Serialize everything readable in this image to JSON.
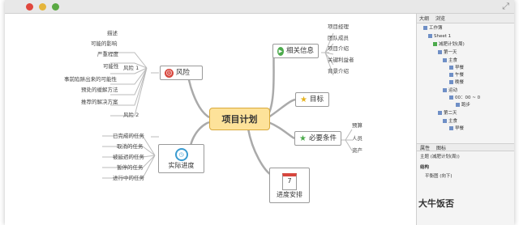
{
  "window": {
    "controls": [
      "close",
      "minimize",
      "zoom"
    ]
  },
  "map": {
    "central": "项目计划",
    "risk": {
      "label": "风险",
      "sub1": "风险 1",
      "sub2": "风险 2",
      "leaves": [
        "描述",
        "可能的影响",
        "严重程度",
        "可能性",
        "事前陷阱出来的可能性",
        "预处的缓解方法",
        "推荐的解决方案"
      ]
    },
    "progress": {
      "label": "实际进度",
      "leaves": [
        "已完成的任务",
        "取消的任务",
        "被延迟的任务",
        "暂停的任务",
        "进行中的任务"
      ]
    },
    "info": {
      "label": "相关信息",
      "leaves": [
        "项目经理",
        "团队成员",
        "项目介绍",
        "关键利益者",
        "背景介绍"
      ]
    },
    "goal": {
      "label": "目标"
    },
    "conditions": {
      "label": "必要条件",
      "leaves": [
        "预算",
        "人员",
        "资产"
      ]
    },
    "schedule": {
      "label": "进度安排",
      "day": "7"
    }
  },
  "panel": {
    "tabs": [
      "大纲",
      "浏览"
    ],
    "tree": [
      "工作簿",
      "Sheet 1",
      "减肥计划(周)",
      "第一天",
      "主食",
      "早餐",
      "午餐",
      "晚餐",
      "运动",
      "00：00 ~ 0",
      "跑步",
      "第二天",
      "主食",
      "早餐"
    ],
    "bottom_tabs": [
      "属性",
      "图标"
    ],
    "topic_label": "主题 (减肥计划(周))",
    "struct_label": "结构",
    "struct_value": "平衡图 (向下)"
  },
  "watermark": "大牛饭否"
}
